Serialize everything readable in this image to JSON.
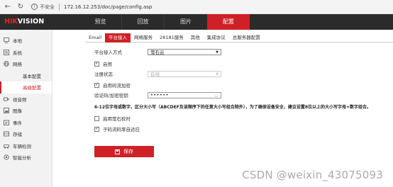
{
  "browser": {
    "security_label": "不安全",
    "url": "172.16.12.253/doc/page/config.asp"
  },
  "brand": {
    "logo_red": "HIK",
    "logo_white": "VISION"
  },
  "mainnav": [
    "预览",
    "回放",
    "图片",
    "配置"
  ],
  "sidebar": {
    "items": [
      {
        "label": "本地",
        "icon": "monitor-icon"
      },
      {
        "label": "系统",
        "icon": "system-icon"
      },
      {
        "label": "网络",
        "icon": "globe-icon"
      }
    ],
    "network_sub": [
      "基本配置",
      "高级配置"
    ],
    "items2": [
      {
        "label": "视音频",
        "icon": "video-audio-icon"
      },
      {
        "label": "图像",
        "icon": "image-icon"
      },
      {
        "label": "事件",
        "icon": "event-icon"
      },
      {
        "label": "存储",
        "icon": "storage-icon"
      },
      {
        "label": "车辆检测",
        "icon": "vehicle-icon"
      },
      {
        "label": "智能分析",
        "icon": "smart-analysis-icon"
      }
    ]
  },
  "tabs": [
    "Email",
    "平台接入",
    "网络服务",
    "28181服务",
    "其他",
    "集成协议",
    "总服务器配置"
  ],
  "form": {
    "platform_label": "平台接入方式",
    "platform_value": "萤石云",
    "enable_label": "启用",
    "status_label": "注册状态",
    "status_value": "在线",
    "encrypt_label": "启用码流加密",
    "code_label": "验证码/加密密钥",
    "code_value": "••••••",
    "hint": "6-12位字母或数字，区分大小写（ABCDEF及该顺序下的任意大小写组合除外），为了确保设备安全，建议设置8位以上的大小写字母+数字组合。",
    "ezviz_calib_label": "启用萤石校时",
    "substream_label": "子码流码率自适应",
    "save_label": "保存"
  },
  "watermark": "CSDN @weixin_43075093",
  "colors": {
    "accent": "#cf2027",
    "topbar": "#2b2b2b"
  }
}
